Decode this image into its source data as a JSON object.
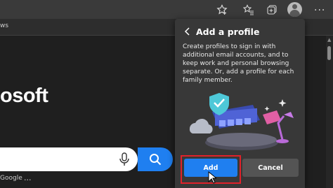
{
  "toolbar": {
    "icons": [
      "favorite-add-icon",
      "favorites-icon",
      "collections-icon",
      "profile-avatar",
      "more-options-icon"
    ],
    "more_label": "..."
  },
  "favorites_bar": {
    "partial_label": "ws"
  },
  "page": {
    "brand_partial": "osoft",
    "google_label": "Google",
    "more_dots": "..."
  },
  "flyout": {
    "title": "Add a profile",
    "description": "Create profiles to sign in with additional email accounts, and to keep work and personal browsing separate. Or, add a profile for each family member.",
    "add_label": "Add",
    "cancel_label": "Cancel"
  },
  "colors": {
    "accent": "#1f7ff0",
    "highlight": "#e0222a",
    "flyout_bg": "#383838"
  }
}
